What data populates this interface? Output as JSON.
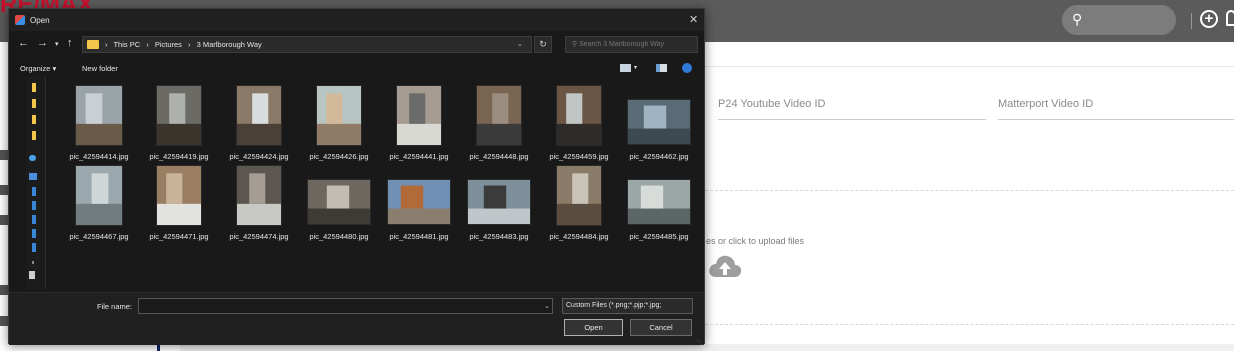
{
  "app": {
    "logo": "RE/MAX",
    "fields": {
      "p24_youtube_video_id": "P24 Youtube Video ID",
      "matterport_video_id": "Matterport Video ID"
    },
    "upload_text": "es or click to upload files"
  },
  "dialog": {
    "title": "Open",
    "path": [
      "This PC",
      "Pictures",
      "3 Marlborough Way"
    ],
    "search_placeholder": "Search 3 Marlborough Way",
    "toolbar": {
      "organize": "Organize",
      "new_folder": "New folder"
    },
    "files": [
      {
        "name": "pic_42594414.jpg",
        "colors": [
          "#9aa3a8",
          "#c9cfd2",
          "#6a5a48"
        ]
      },
      {
        "name": "pic_42594419.jpg",
        "colors": [
          "#6c6a65",
          "#aeb1ae",
          "#3b342d"
        ]
      },
      {
        "name": "pic_42594424.jpg",
        "colors": [
          "#8b7968",
          "#d9dcdc",
          "#4a4038"
        ]
      },
      {
        "name": "pic_42594426.jpg",
        "colors": [
          "#b8c6c3",
          "#d1b99a",
          "#8f7b66"
        ]
      },
      {
        "name": "pic_42594441.jpg",
        "colors": [
          "#a59b90",
          "#6b6b6b",
          "#d8d8d2"
        ]
      },
      {
        "name": "pic_42594448.jpg",
        "colors": [
          "#7a6552",
          "#9a8d80",
          "#3a3a3a"
        ]
      },
      {
        "name": "pic_42594459.jpg",
        "colors": [
          "#6b5645",
          "#c1c6c4",
          "#2e2b28"
        ]
      },
      {
        "name": "pic_42594462.jpg",
        "colors": [
          "#5a6b78",
          "#9fb3c2",
          "#3d4a52"
        ]
      },
      {
        "name": "pic_42594467.jpg",
        "colors": [
          "#9aa7ac",
          "#cfd6d8",
          "#707c80"
        ]
      },
      {
        "name": "pic_42594471.jpg",
        "colors": [
          "#9a7e64",
          "#c9b49a",
          "#e2e2de"
        ]
      },
      {
        "name": "pic_42594474.jpg",
        "colors": [
          "#5c5650",
          "#a59d94",
          "#c8c8c4"
        ]
      },
      {
        "name": "pic_42594480.jpg",
        "colors": [
          "#6e675f",
          "#c1bdb5",
          "#3e3a36"
        ]
      },
      {
        "name": "pic_42594481.jpg",
        "colors": [
          "#6f8fb5",
          "#b26a38",
          "#8a7f6e"
        ]
      },
      {
        "name": "pic_42594483.jpg",
        "colors": [
          "#7d8f9a",
          "#3b3b3b",
          "#c0c7ca"
        ]
      },
      {
        "name": "pic_42594484.jpg",
        "colors": [
          "#8a7a68",
          "#c9c3b8",
          "#5a4d40"
        ]
      },
      {
        "name": "pic_42594485.jpg",
        "colors": [
          "#9ba6a6",
          "#d8dcd8",
          "#5c6666"
        ]
      }
    ],
    "footer": {
      "file_name_label": "File name:",
      "file_name_value": "",
      "file_type": "Custom Files (*.png;*.pjp;*.jpg;",
      "open_label": "Open",
      "cancel_label": "Cancel"
    }
  }
}
